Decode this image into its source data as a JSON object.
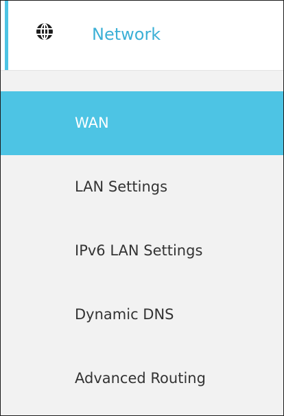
{
  "header": {
    "title": "Network",
    "icon": "globe-icon",
    "accent_color": "#4dc4e4",
    "title_color": "#3cb0d6"
  },
  "menu": {
    "items": [
      {
        "label": "WAN",
        "active": true
      },
      {
        "label": "LAN Settings",
        "active": false
      },
      {
        "label": "IPv6 LAN Settings",
        "active": false
      },
      {
        "label": "Dynamic DNS",
        "active": false
      },
      {
        "label": "Advanced Routing",
        "active": false
      }
    ]
  }
}
